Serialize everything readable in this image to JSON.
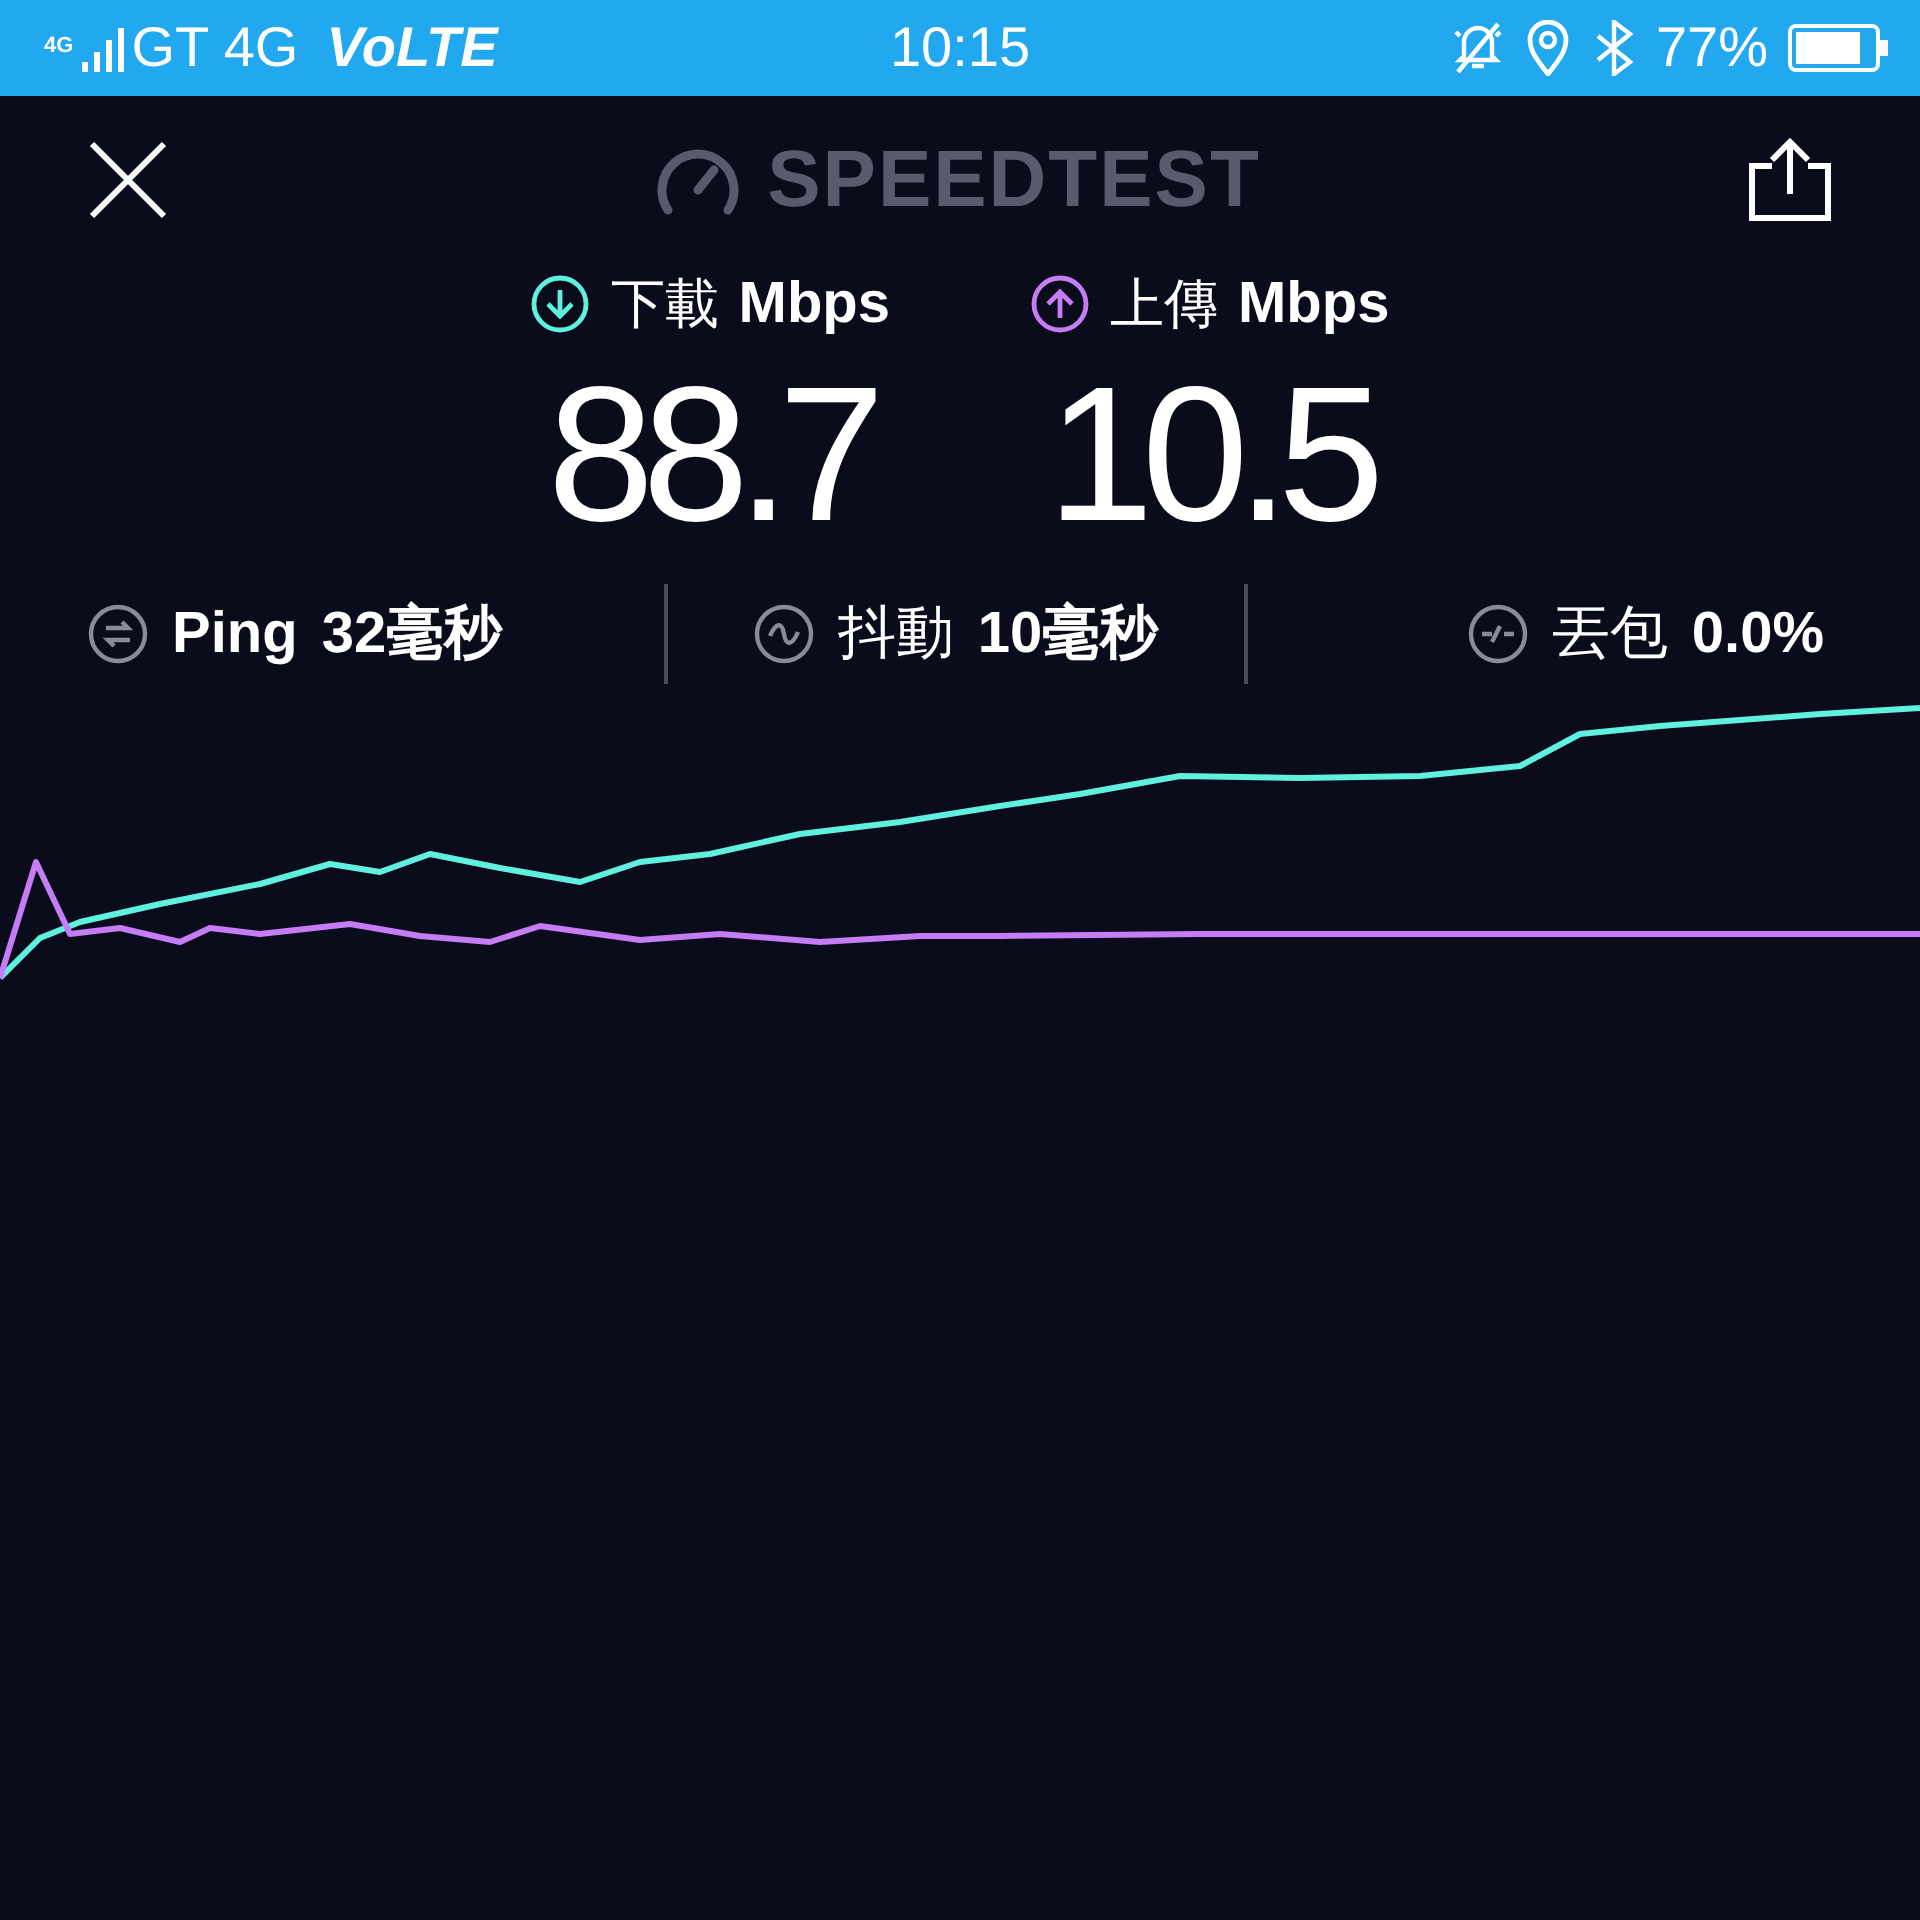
{
  "status_bar": {
    "network_badge": "4G",
    "carrier": "GT 4G",
    "volte": "VoLTE",
    "time": "10:15",
    "battery": "77%"
  },
  "header": {
    "title": "SPEEDTEST"
  },
  "speeds": [
    {
      "kind": "download",
      "label": "下載",
      "unit": "Mbps",
      "value": "88.7",
      "color": "#5ff0e0"
    },
    {
      "kind": "upload",
      "label": "上傳",
      "unit": "Mbps",
      "value": "10.5",
      "color": "#c57cf5"
    }
  ],
  "stats": [
    {
      "kind": "ping",
      "label": "Ping",
      "value": "32毫秒"
    },
    {
      "kind": "jitter",
      "label": "抖動",
      "value": "10毫秒"
    },
    {
      "kind": "loss",
      "label": "丟包",
      "value": "0.0%"
    }
  ]
}
